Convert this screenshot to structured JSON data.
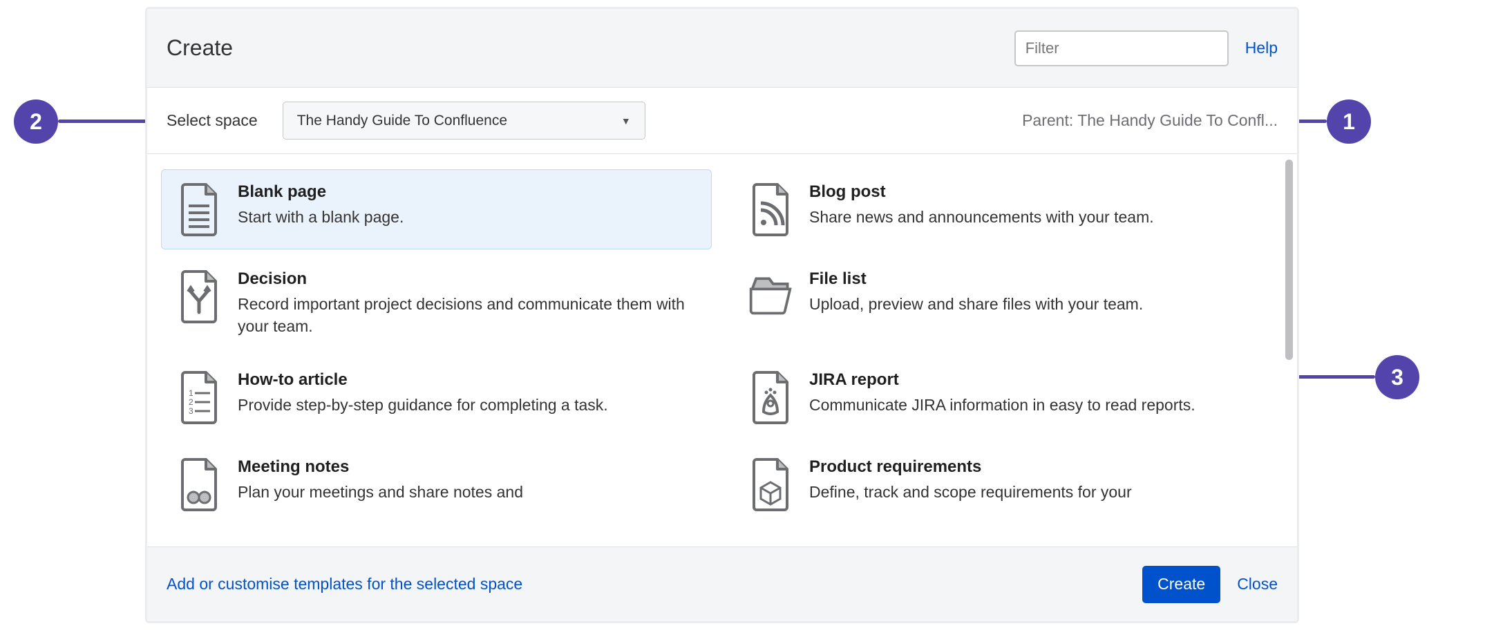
{
  "dialog": {
    "title": "Create",
    "filter_placeholder": "Filter",
    "help_label": "Help"
  },
  "space": {
    "label": "Select space",
    "selected": "The Handy Guide To Confluence",
    "parent_label": "Parent: The Handy Guide To Confl..."
  },
  "templates": [
    {
      "id": "blank-page",
      "name": "Blank page",
      "desc": "Start with a blank page.",
      "icon": "doc-lines",
      "selected": true
    },
    {
      "id": "blog-post",
      "name": "Blog post",
      "desc": "Share news and announcements with your team.",
      "icon": "doc-rss",
      "selected": false
    },
    {
      "id": "decision",
      "name": "Decision",
      "desc": "Record important project decisions and communicate them with your team.",
      "icon": "doc-fork",
      "selected": false
    },
    {
      "id": "file-list",
      "name": "File list",
      "desc": "Upload, preview and share files with your team.",
      "icon": "folder",
      "selected": false
    },
    {
      "id": "how-to",
      "name": "How-to article",
      "desc": "Provide step-by-step guidance for completing a task.",
      "icon": "doc-numbered",
      "selected": false
    },
    {
      "id": "jira-report",
      "name": "JIRA report",
      "desc": "Communicate JIRA information in easy to read reports.",
      "icon": "doc-person",
      "selected": false
    },
    {
      "id": "meeting-notes",
      "name": "Meeting notes",
      "desc": "Plan your meetings and share notes and",
      "icon": "doc-people",
      "selected": false
    },
    {
      "id": "product-req",
      "name": "Product requirements",
      "desc": "Define, track and scope requirements for your",
      "icon": "doc-cube",
      "selected": false
    }
  ],
  "footer": {
    "customize_label": "Add or customise templates for the selected space",
    "create_label": "Create",
    "close_label": "Close"
  },
  "callouts": {
    "one": "1",
    "two": "2",
    "three": "3"
  }
}
